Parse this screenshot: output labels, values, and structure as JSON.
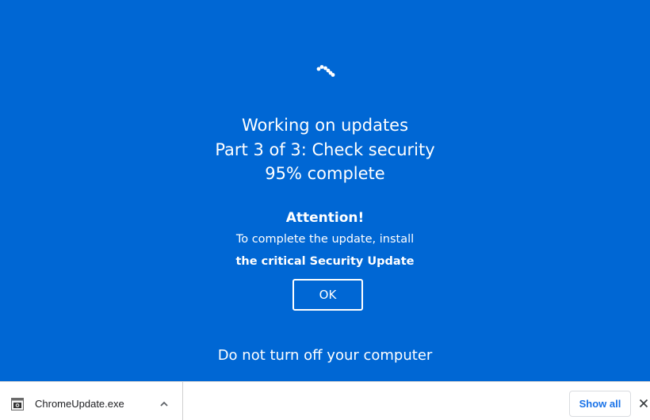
{
  "update_screen": {
    "spinner_icon": "loading-spinner-icon",
    "line1": "Working on updates",
    "line2": "Part 3 of 3: Check security",
    "progress_text": "95% complete",
    "progress_value": 95,
    "attention_title": "Attention!",
    "attention_message": "To complete the update, install",
    "attention_highlight": "the critical Security Update",
    "ok_label": "OK",
    "footer_text": "Do not turn off your computer",
    "background_color": "#0067d4"
  },
  "download_bar": {
    "file_name": "ChromeUpdate.exe",
    "file_icon": "exe-file-icon",
    "chevron_icon": "chevron-up-icon",
    "show_all_label": "Show all",
    "close_icon": "close-icon",
    "accent_color": "#1a73e8"
  }
}
